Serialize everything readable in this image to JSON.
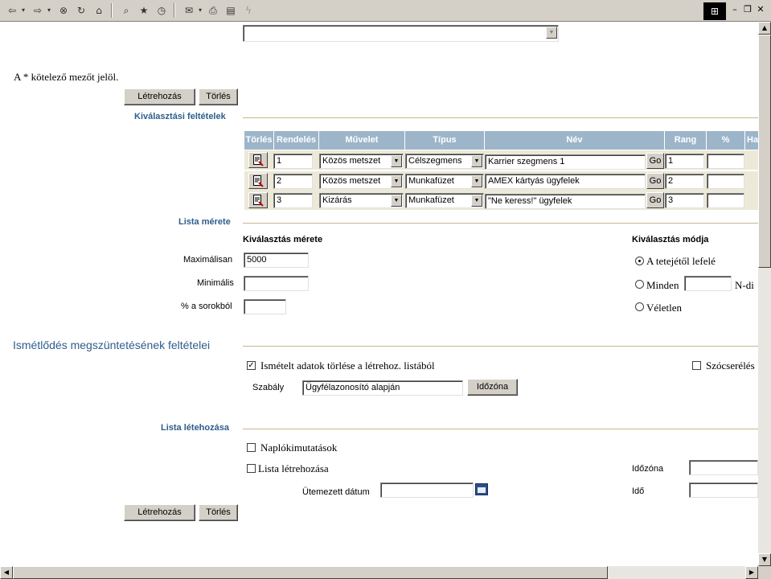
{
  "required_note": "A * kötelező mezőt jelöl.",
  "buttons": {
    "create": "Létrehozás",
    "delete": "Törlés",
    "go": "Go",
    "timezone": "Időzóna"
  },
  "selection_criteria": {
    "title": "Kiválasztási feltételek",
    "columns": [
      "Törlés",
      "Rendelés",
      "Művelet",
      "Típus",
      "Név",
      "Rang",
      "%",
      "Ha"
    ],
    "rows": [
      {
        "order": "1",
        "operation": "Közös metszet",
        "type": "Célszegmens",
        "name": "Karrier szegmens 1",
        "rank": "1",
        "percent": ""
      },
      {
        "order": "2",
        "operation": "Közös metszet",
        "type": "Munkafüzet",
        "name": "AMEX kártyás ügyfelek",
        "rank": "2",
        "percent": ""
      },
      {
        "order": "3",
        "operation": "Kizárás",
        "type": "Munkafüzet",
        "name": "\"Ne keress!\" ügyfelek",
        "rank": "3",
        "percent": ""
      }
    ]
  },
  "list_size": {
    "title": "Lista mérete",
    "size_heading": "Kiválasztás mérete",
    "max_label": "Maximálisan",
    "max_value": "5000",
    "min_label": "Minimális",
    "min_value": "",
    "pct_label": "% a sorokból",
    "pct_value": "",
    "mode_heading": "Kiválasztás módja",
    "mode_top": "A tetejétől lefelé",
    "mode_every": "Minden",
    "mode_nth": "N-di",
    "mode_random": "Véletlen"
  },
  "dedup": {
    "title": "Ismétlődés megszüntetésének feltételei",
    "remove_label": "Ismételt adatok törlése a létrehoz. listából",
    "remove_checked": true,
    "word_replace_label": "Szócserélés",
    "rule_label": "Szabály",
    "rule_value": "Ügyfélazonosító alapján"
  },
  "list_creation": {
    "title": "Lista létehozása",
    "log_reports": "Naplókimutatások",
    "create_list": "Lista létrehozása",
    "scheduled_date": "Ütemezett dátum",
    "timezone_label": "Időzóna",
    "time_label": "Idő"
  }
}
